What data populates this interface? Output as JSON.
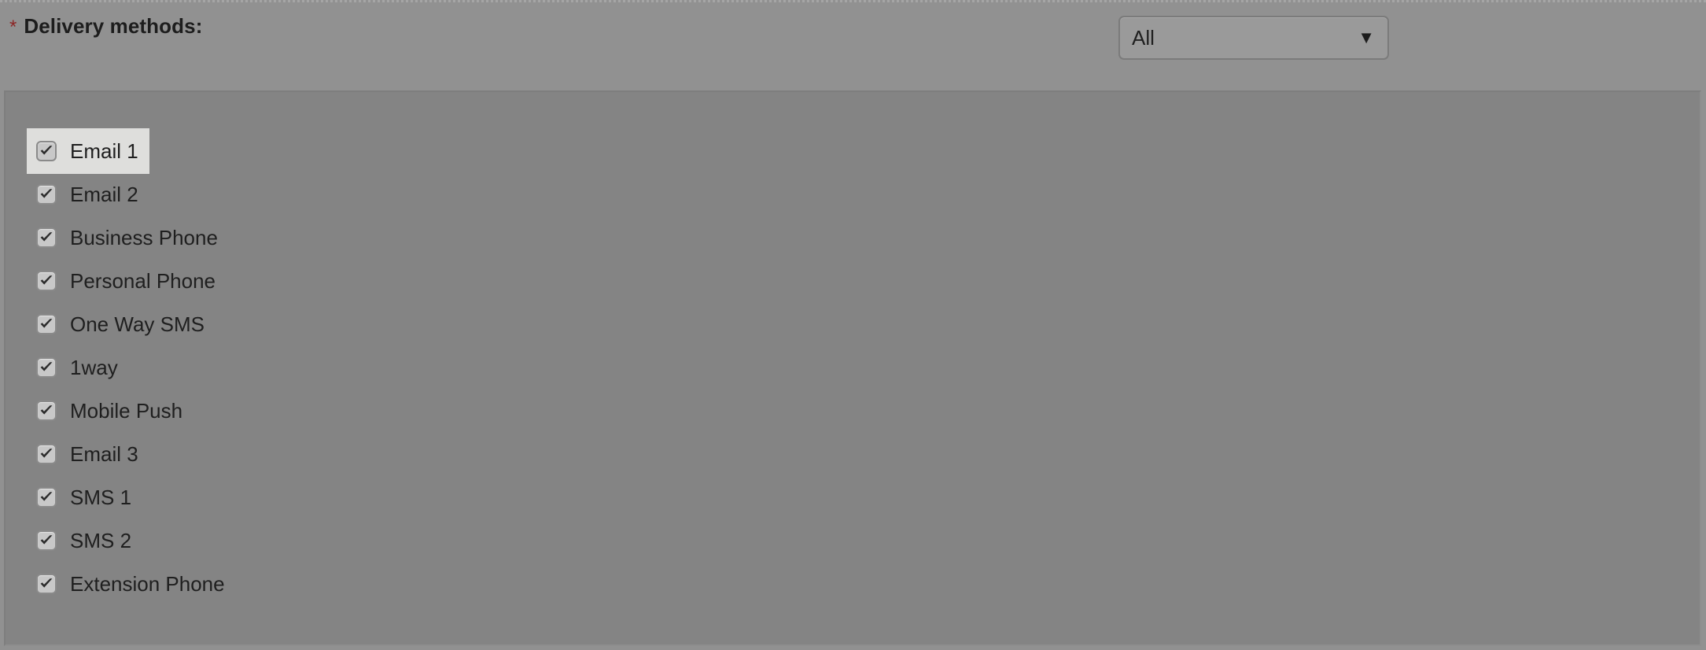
{
  "form": {
    "required_marker": "*",
    "label": "Delivery methods:",
    "filter": {
      "name": "delivery-methods-filter",
      "selected": "All",
      "arrow_glyph": "▼"
    }
  },
  "panel": {
    "check_glyph": "✔",
    "options": [
      {
        "label": "Email 1",
        "checked": true,
        "selected": true
      },
      {
        "label": "Email 2",
        "checked": true,
        "selected": false
      },
      {
        "label": "Business Phone",
        "checked": true,
        "selected": false
      },
      {
        "label": "Personal Phone",
        "checked": true,
        "selected": false
      },
      {
        "label": "One Way SMS",
        "checked": true,
        "selected": false
      },
      {
        "label": "1way",
        "checked": true,
        "selected": false
      },
      {
        "label": "Mobile Push",
        "checked": true,
        "selected": false
      },
      {
        "label": "Email 3",
        "checked": true,
        "selected": false
      },
      {
        "label": "SMS 1",
        "checked": true,
        "selected": false
      },
      {
        "label": "SMS 2",
        "checked": true,
        "selected": false
      },
      {
        "label": "Extension Phone",
        "checked": true,
        "selected": false
      }
    ]
  },
  "colors": {
    "page_background": "#919191",
    "panel_background": "#848484",
    "selected_row": "#dededc",
    "required_marker": "#8c2626",
    "text": "#1f1f1f"
  }
}
